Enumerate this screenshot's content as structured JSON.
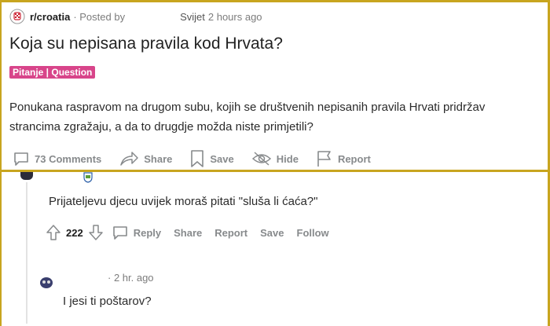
{
  "post": {
    "subreddit": "r/croatia",
    "posted_by": "· Posted by",
    "author": "Svijet",
    "time": "2 hours ago",
    "title": "Koja su nepisana pravila kod Hrvata?",
    "flair": "Pitanje | Question",
    "body_line1": "Ponukana raspravom na drugom subu, kojih se društvenih nepisanih pravila Hrvati pridržav",
    "body_line2": "strancima zgražaju, a da to drugdje možda niste primjetili?",
    "actions": {
      "comments": "73 Comments",
      "share": "Share",
      "save": "Save",
      "hide": "Hide",
      "report": "Report"
    }
  },
  "comment1": {
    "text": "Prijateljevu djecu uvijek moraš pitati \"sluša li ćaća?\"",
    "score": "222",
    "reply": "Reply",
    "share": "Share",
    "report": "Report",
    "save": "Save",
    "follow": "Follow"
  },
  "comment2": {
    "time": "· 2 hr. ago",
    "text": "I jesi ti poštarov?"
  },
  "colors": {
    "frame": "#c8a51f",
    "flair_bg": "#d8458a",
    "muted": "#878a8c"
  }
}
